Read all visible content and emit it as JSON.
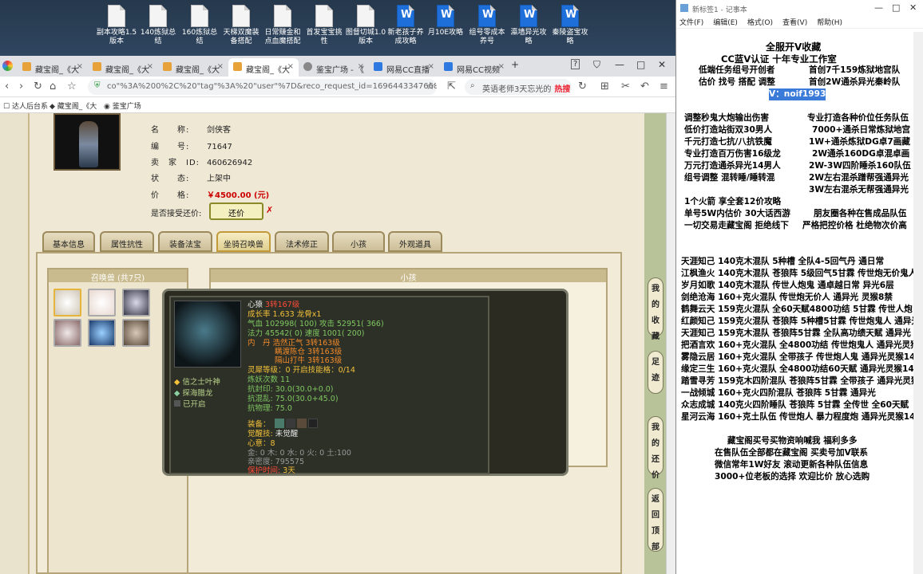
{
  "desktop_icons": [
    "副本攻略1.5版本",
    "140炼狱总结",
    "160炼狱总结",
    "天梯双魔装备搭配",
    "日常赚金和点血魔搭配",
    "首发宝宝挑性",
    "图督切城1.0版本",
    "新老孩子养成攻略",
    "月10E攻略",
    "组号零成本养号",
    "瀛墙异光攻略",
    "秦陵盗宝攻略"
  ],
  "tabs": [
    {
      "label": "藏宝阁_《大"
    },
    {
      "label": "藏宝阁_《大"
    },
    {
      "label": "藏宝阁_《大"
    },
    {
      "label": "藏宝阁_《大"
    },
    {
      "label": "鉴宝广场 - 《"
    },
    {
      "label": "网易CC直播"
    },
    {
      "label": "网易CC视频"
    }
  ],
  "address": {
    "url": "co\"%3A%200%2C%20\"tag\"%3A%20\"user\"%7D&reco_request_id=1696443347668yvHIT",
    "search": "英语老师3天忘光的",
    "hot": "热搜"
  },
  "bookmarks": [
    "达人后台系",
    "藏宝阁_《大",
    "鉴宝广场"
  ],
  "item": {
    "name_label": "名　　称:",
    "name": "剑侠客",
    "id_label": "编　　号:",
    "id": "71647",
    "seller_label": "卖　家　ID:",
    "seller": "460626942",
    "status_label": "状　　态:",
    "status": "上架中",
    "price_label": "价　　格:",
    "price": "￥4500.00 (元)",
    "bargain_label": "是否接受还价:",
    "bargain_btn": "还价"
  },
  "game_tabs": [
    "基本信息",
    "属性抗性",
    "装备法宝",
    "坐骑召唤兽",
    "法术修正",
    "小孩",
    "外观道具"
  ],
  "summon_header": "召唤兽 (共7只)",
  "kid_header": "小孩",
  "tooltip": {
    "name": "心猿",
    "level": "3转167级",
    "growth": "成长率 1.633 龙骨x1",
    "hp": "气血 102998( 100) 攻击 52951( 366)",
    "mp": "法力 45542( 0) 速度 1001( 200)",
    "inner1": "内　丹 浩然正气 3转163级",
    "inner2": "瞒渡陈仓 3转163级",
    "inner3": "隔山打牛 3转163级",
    "sp": "灵犀等级：0 开启技能格：0/14",
    "refine": "炼妖次数 11",
    "seal": "抗封印: 30.0(30.0+0.0)",
    "chaos": "抗混乱: 75.0(30.0+45.0)",
    "phys": "抗物理: 75.0",
    "equip_label": "装备：",
    "awaken_label": "觉醒技:",
    "awaken": "未觉醒",
    "heart": "心意：8",
    "elements": "金: 0 木: 0 水: 0 火: 0 土:100",
    "intimacy": "亲密度: 795575",
    "protect_label": "保护时间:",
    "protect": "3天",
    "skills": [
      "信之士叶神",
      "探海腊龙",
      "已开启"
    ]
  },
  "side_buttons": [
    "我的收藏",
    "足迹",
    "我的还价",
    "返回顶部"
  ],
  "notepad": {
    "title": "新标签1 - 记事本",
    "menu": [
      "文件(F)",
      "编辑(E)",
      "格式(O)",
      "查看(V)",
      "帮助(H)"
    ],
    "lines": [
      "全服开V收藏",
      "CC蓝V认证 十年专业工作室",
      "低端任务组号开创者",
      "首创7千159炼狱地宫队",
      "估价 找号 搭配 调整",
      "首创2W通杀异光秦岭队",
      "V：noif1993",
      "调整秒鬼大炮输出伤害",
      "专业打造各种价位任务队伍",
      "低价打造站街双30男人",
      "7000+通杀日常炼狱地宫",
      "千元打造七抗/八抗铁魔",
      "1W+通杀炼狱DG卓7画藏",
      "专业打造百万伤害16级龙",
      "2W通杀160DG卓混卓画",
      "万元打造通杀异光14男人",
      "2W-3W四阶睡杀160队伍",
      "组号调整 混转睡/睡转混",
      "2W左右混杀蹭帮强通异光",
      "3W左右混杀无帮强通异光",
      "1个火箭 享全套12价攻略",
      "单号5W内估价 30大话西游",
      "朋友圈各种在售成品队伍",
      "一切交易走藏宝阁 拒绝线下",
      "严格把控价格 杜绝物次价高",
      "天涯知己 140克木混队 5种槽 全队4-5回气丹 通日常",
      "江枫渔火 140克木混队 苍狼阵 5级回气5甘霖 传世炮无价鬼人",
      "岁月如歌 140克木混队 传世人炮鬼 通卓越日常 异光6层",
      "剑绝沧海 160+克火混队 传世炮无价人 通异光 灵猴8禁",
      "鹤舞云天 159克火混队 全60天赋4800功结 5甘霖 传世人炮",
      "红颜知己 159克火混队 苍狼阵 5种槽5甘霖 传世炮鬼人 通异光",
      "天涯知己 159克木混队 苍狼阵5甘霖 全队高功绩天赋 通异光",
      "把酒言欢 160+克火混队 全4800功结 传世炮鬼人 通异光灵猴",
      "雾隐云居 160+克火混队 全带孩子 传世炮人鬼 通异光灵猴14",
      "缘定三生 160+克火混队 全4800功结60天赋 通异光灵猴14",
      "踏雪寻芳 159克木四阶混队 苍狼阵5甘霖 全带孩子 通异光灵猴",
      "一战倾城 160+克火四阶混队 苍狼阵 5甘霖 通异光",
      "众志成城 140克火四阶睡队 苍狼阵 5甘霖 全传世 全60天赋",
      "星河云海 160+克土队伍 传世炮人 暴力程度炮 通异光灵猴14",
      "藏宝阁买号买物资响喊我 福利多多",
      "在售队伍全部都在藏宝阁 买卖号加V联系",
      "微信常年1W好友 滚动更新各种队伍信息",
      "3000+位老板的选择 欢迎比价 放心选购"
    ]
  },
  "colors": {
    "accent_gold": "#c29a3a",
    "price_red": "#cc0000",
    "tooltip_bg": "#2b2b22",
    "select_blue": "#3a7ad8"
  }
}
